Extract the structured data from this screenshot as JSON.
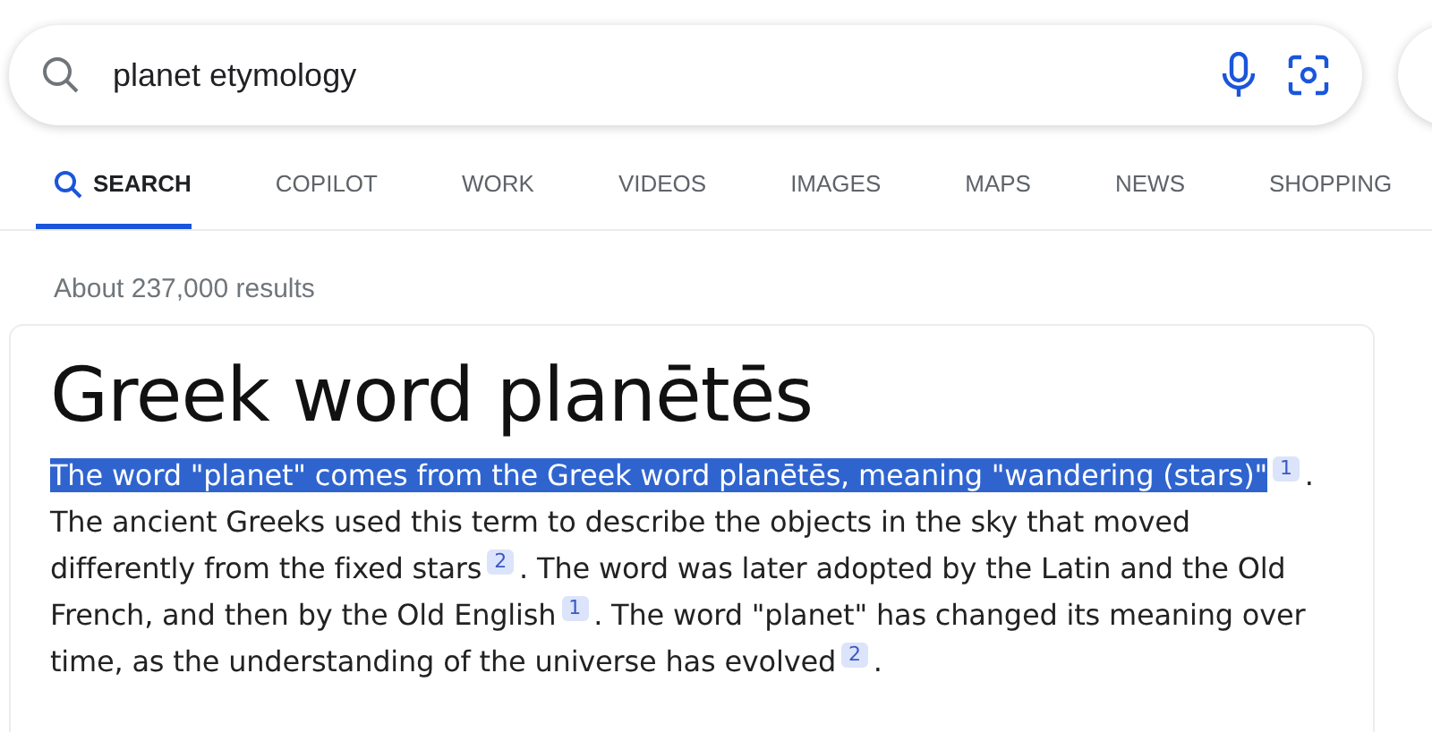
{
  "search": {
    "value": "planet etymology"
  },
  "tabs": [
    {
      "label": "SEARCH",
      "selected": true
    },
    {
      "label": "COPILOT",
      "selected": false
    },
    {
      "label": "WORK",
      "selected": false
    },
    {
      "label": "VIDEOS",
      "selected": false
    },
    {
      "label": "IMAGES",
      "selected": false
    },
    {
      "label": "MAPS",
      "selected": false
    },
    {
      "label": "NEWS",
      "selected": false
    },
    {
      "label": "SHOPPING",
      "selected": false
    }
  ],
  "result_count": "About 237,000 results",
  "answer": {
    "title": "Greek word planētēs",
    "segments": [
      {
        "kind": "text",
        "text": "The word \"planet\" comes from the Greek word planētēs, meaning \"wandering (stars)\"",
        "selected": true
      },
      {
        "kind": "cite",
        "text": "1"
      },
      {
        "kind": "text",
        "text": ". The ancient Greeks used this term to describe the objects in the sky that moved differently from the fixed stars",
        "selected": false
      },
      {
        "kind": "cite",
        "text": "2"
      },
      {
        "kind": "text",
        "text": ". The word was later adopted by the Latin and the Old French, and then by the Old English",
        "selected": false
      },
      {
        "kind": "cite",
        "text": "1"
      },
      {
        "kind": "text",
        "text": ". The word \"planet\" has changed its meaning over time, as the understanding of the universe has evolved",
        "selected": false
      },
      {
        "kind": "cite",
        "text": "2"
      },
      {
        "kind": "text",
        "text": ".",
        "selected": false
      }
    ]
  }
}
